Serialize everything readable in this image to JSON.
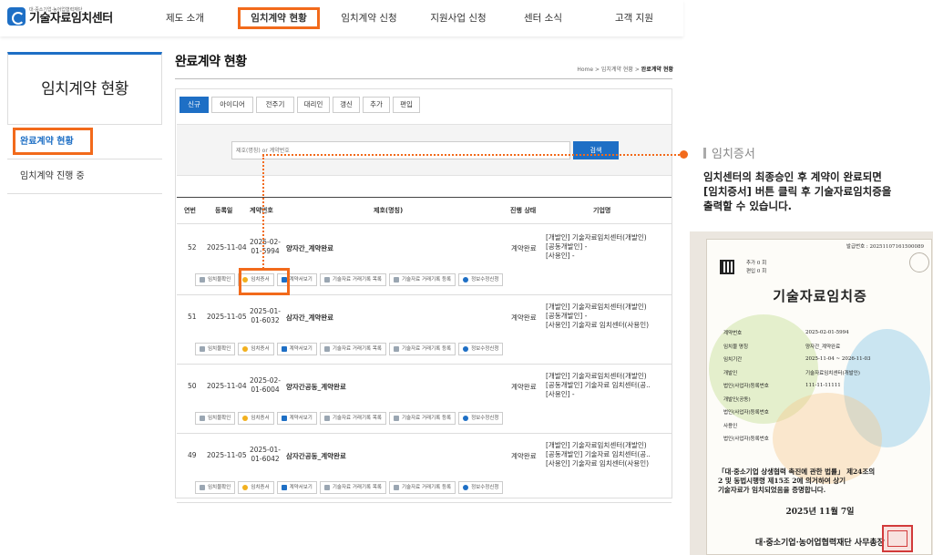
{
  "header": {
    "logo_sub": "대·중소기업·농어업협력재단",
    "logo_title": "기술자료임치센터",
    "nav": [
      "제도 소개",
      "임치계약 현황",
      "임치계약 신청",
      "지원사업 신청",
      "센터 소식",
      "고객 지원"
    ]
  },
  "lnb": {
    "title": "임치계약 현황",
    "items": [
      "완료계약 현황",
      "임치계약 진행 중"
    ]
  },
  "content": {
    "title": "완료계약 현황",
    "breadcrumb": [
      "Home",
      "임치계약 현황",
      "완료계약 현황"
    ]
  },
  "tabs": [
    "신규",
    "아이디어",
    "전주기",
    "대리인",
    "갱신",
    "추가",
    "편입"
  ],
  "search": {
    "placeholder": "제호(명칭) or 계약번호",
    "button": "검색"
  },
  "table": {
    "headers": [
      "연번",
      "등록일",
      "계약번호",
      "제호(명칭)",
      "진행 상태",
      "기업명"
    ],
    "rows": [
      {
        "no": "52",
        "date": "2025-11-04",
        "contract": [
          "2025-02-",
          "01-5994"
        ],
        "name": "양자간_계약완료",
        "status": "계약완료",
        "org": [
          "[개발인] 기술자료임치센터(개발인)",
          "[공동개발인] -",
          "[사용인] -"
        ]
      },
      {
        "no": "51",
        "date": "2025-11-05",
        "contract": [
          "2025-01-",
          "01-6032"
        ],
        "name": "삼자간_계약완료",
        "status": "계약완료",
        "org": [
          "[개발인] 기술자료임치센터(개발인)",
          "[공동개발인] -",
          "[사용인] 기술자료 임치센터(사용인)"
        ]
      },
      {
        "no": "50",
        "date": "2025-11-04",
        "contract": [
          "2025-02-",
          "01-6004"
        ],
        "name": "양자간공동_계약완료",
        "status": "계약완료",
        "org": [
          "[개발인] 기술자료임치센터(개발인)",
          "[공동개발인] 기술자료 임치센터(공..",
          "[사용인] -"
        ]
      },
      {
        "no": "49",
        "date": "2025-11-05",
        "contract": [
          "2025-01-",
          "01-6042"
        ],
        "name": "삼자간공동_계약완료",
        "status": "계약완료",
        "org": [
          "[개발인] 기술자료임치센터(개발인)",
          "[공동개발인] 기술자료 임치센터(공..",
          "[사용인] 기술자료 임치센터(사용인)"
        ]
      }
    ],
    "actions": [
      "임치물확인",
      "임치증서",
      "계약서보기",
      "기술자료 거래기록 목록",
      "기술자료 거래기록 등록",
      "정보수정신청"
    ]
  },
  "annotation": {
    "title": "임치증서",
    "lines": [
      "임치센터의 최종승인 후 계약이 완료되면",
      "[임치증서] 버튼 클릭 후 기술자료임치증을",
      "출력할 수 있습니다."
    ]
  },
  "certificate": {
    "issue_no": "발급번호 : 20251107161500089",
    "copy": [
      "추가 0 회",
      "편입 0 회"
    ],
    "heading": "기술자료임치증",
    "fields": [
      {
        "label": "계약번호",
        "value": "2025-02-01-5994"
      },
      {
        "label": "임치물 명칭",
        "value": "양자간_계약완료"
      },
      {
        "label": "임치기간",
        "value": "2025-11-04 ~ 2026-11-03"
      },
      {
        "label": "개발인",
        "value": "기술자료임치센터(개발인)"
      },
      {
        "label": "법인(사업자)등록번호",
        "value": "111-11-11111"
      },
      {
        "label": "개발인(공동)",
        "value": ""
      },
      {
        "label": "법인(사업자)등록번호",
        "value": ""
      },
      {
        "label": "사용인",
        "value": ""
      },
      {
        "label": "법인(사업자)등록번호",
        "value": ""
      }
    ],
    "body": [
      "「대·중소기업 상생협력 촉진에 관한 법률」 제24조의",
      "2 및 동법시행령 제15조 2에 의거하여 상기",
      "기술자료가 임치되었음을 증명합니다."
    ],
    "date": "2025년 11월 7일",
    "issuer": "대·중소기업·농어업협력재단 사무총장"
  },
  "colors": {
    "accent": "#1e6fc5",
    "highlight": "#f26a1b"
  }
}
